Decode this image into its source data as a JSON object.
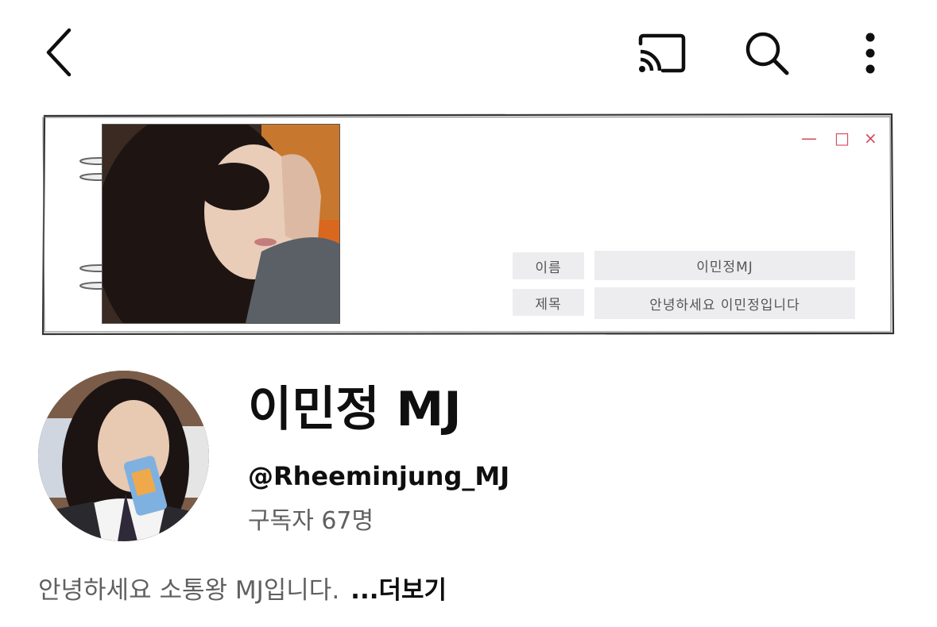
{
  "topbar": {
    "back_icon": "chevron-left-icon",
    "cast_icon": "cast-icon",
    "search_icon": "search-icon",
    "more_icon": "more-vertical-icon"
  },
  "banner": {
    "window_controls": [
      "—",
      "□",
      "×"
    ],
    "name_label": "이름",
    "name_value": "이민정MJ",
    "title_label": "제목",
    "title_value": "안녕하세요 이민정입니다",
    "accent_color": "#d64a5a"
  },
  "channel": {
    "name": "이민정 MJ",
    "handle": "@Rheeminjung_MJ",
    "subscribers": "구독자 67명",
    "description": "안녕하세요 소통왕 MJ입니다.",
    "more_label": "...더보기"
  }
}
